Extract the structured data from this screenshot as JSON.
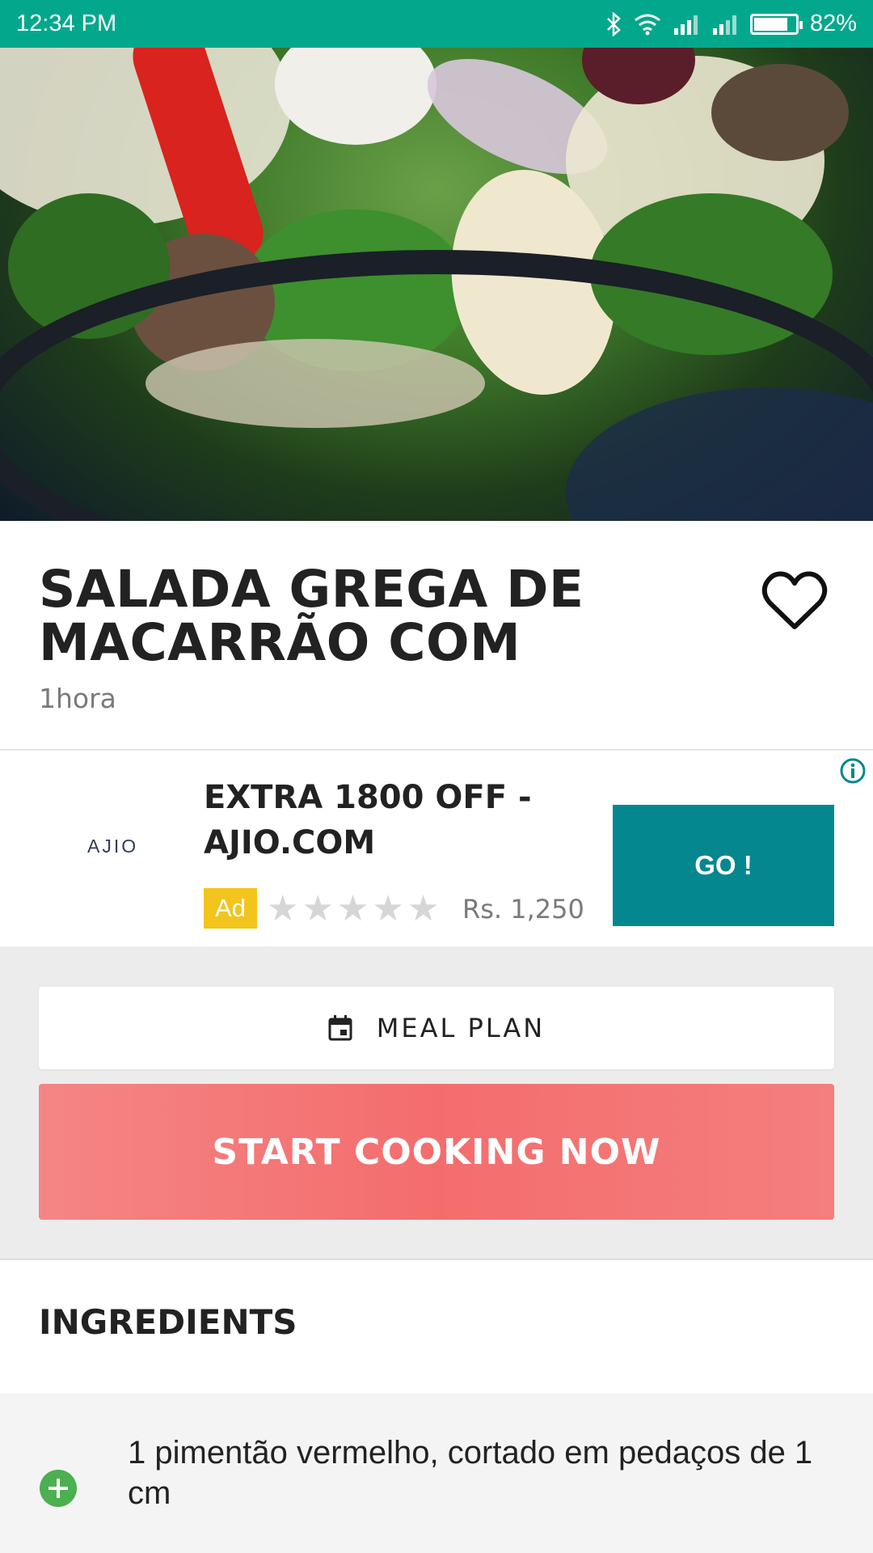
{
  "status_bar": {
    "time": "12:34 PM",
    "battery_text": "82%",
    "battery_level": 0.82,
    "icons": [
      "bluetooth-icon",
      "wifi-icon",
      "signal-icon",
      "signal-icon",
      "battery-icon"
    ]
  },
  "hero": {
    "image": "salad-photo"
  },
  "recipe": {
    "title": "SALADA GREGA DE MACARRÃO COM",
    "time": "1hora",
    "favorite_icon": "heart-outline-icon"
  },
  "ad": {
    "brand": "AJIO",
    "headline": "EXTRA 1800 OFF - AJIO.COM",
    "badge": "Ad",
    "rating": 0,
    "rating_max": 5,
    "price": "Rs. 1,250",
    "cta": "GO !",
    "info_icon": "info-icon"
  },
  "actions": {
    "meal_plan_label": "MEAL PLAN",
    "meal_plan_icon": "calendar-icon",
    "start_cooking_label": "START COOKING NOW"
  },
  "ingredients": {
    "title": "INGREDIENTS",
    "items": [
      {
        "text": "1 pimentão vermelho, cortado em pedaços de 1 cm",
        "icon": "add-circle-icon"
      }
    ]
  },
  "colors": {
    "status_bar": "#03a88c",
    "ad_cta": "#05878f",
    "start_button": "#f46d6d",
    "add_icon": "#4caf50",
    "ad_badge": "#f3c41c"
  }
}
